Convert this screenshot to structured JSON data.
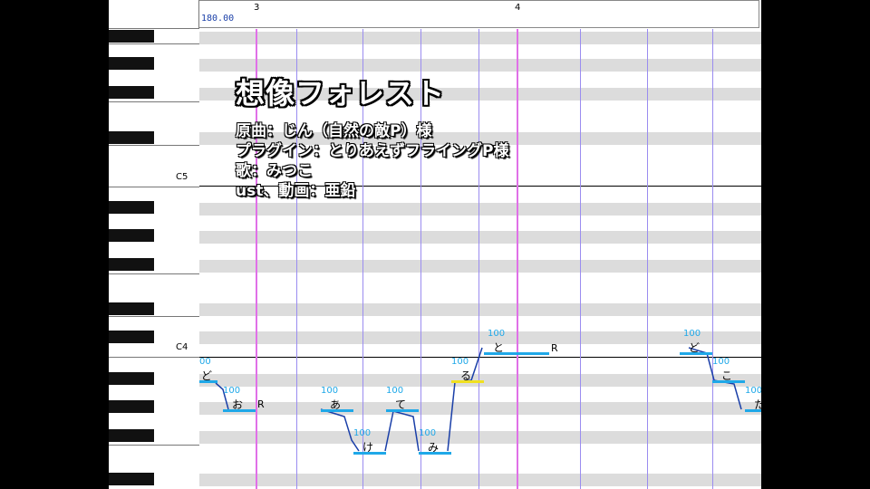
{
  "ruler": {
    "tempo": "180.00",
    "measures": [
      "3",
      "4"
    ]
  },
  "keyboard": {
    "labels": [
      "C5",
      "C4"
    ]
  },
  "overlay": {
    "title": "想像フォレスト",
    "lines": [
      "原曲：じん（自然の敵P）様",
      "プラグイン：とりあえずフライングP様",
      "歌：みつこ",
      "ust、動画：亜鉛"
    ]
  },
  "notes": [
    {
      "lyric": "ど",
      "vel": "00"
    },
    {
      "lyric": "お",
      "vel": "100"
    },
    {
      "lyric": "あ",
      "vel": "100"
    },
    {
      "lyric": "け",
      "vel": "100"
    },
    {
      "lyric": "て",
      "vel": "100"
    },
    {
      "lyric": "み",
      "vel": "100"
    },
    {
      "lyric": "る",
      "vel": "100"
    },
    {
      "lyric": "と",
      "vel": "100"
    },
    {
      "lyric": "ど",
      "vel": "100"
    },
    {
      "lyric": "こ",
      "vel": "100"
    },
    {
      "lyric": "た",
      "vel": "100"
    }
  ],
  "rests": [
    "R",
    "R"
  ],
  "colors": {
    "measure_line": "#e070e8",
    "beat_line": "#9a8cf0",
    "note_bar": "#1fa8e8",
    "selected_note_bar": "#f0e020"
  }
}
